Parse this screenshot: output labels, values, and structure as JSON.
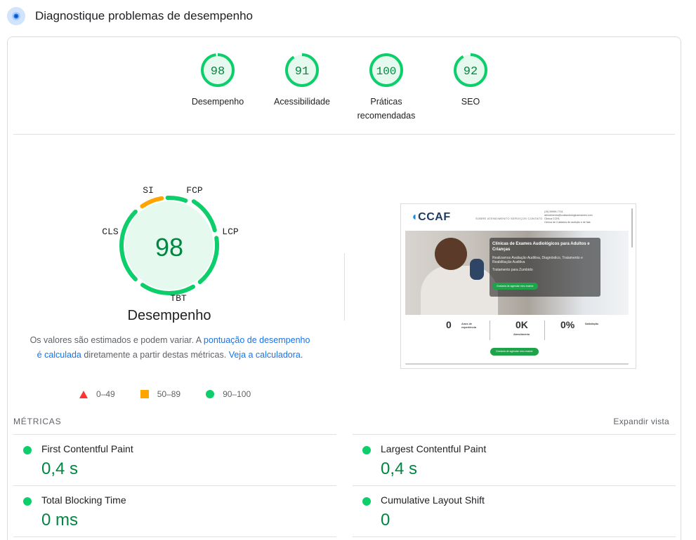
{
  "header": {
    "title": "Diagnostique problemas de desempenho",
    "icon": "lighthouse-icon"
  },
  "scores": [
    {
      "value": 98,
      "label": "Desempenho"
    },
    {
      "value": 91,
      "label": "Acessibilidade"
    },
    {
      "value": 100,
      "label": "Práticas recomendadas"
    },
    {
      "value": 92,
      "label": "SEO"
    }
  ],
  "performance": {
    "score": 98,
    "title": "Desempenho",
    "gauge_labels": {
      "si": "SI",
      "fcp": "FCP",
      "lcp": "LCP",
      "tbt": "TBT",
      "cls": "CLS"
    },
    "desc_1": "Os valores são estimados e podem variar. A ",
    "desc_link_1": "pontuação de desempenho é calculada",
    "desc_2": " diretamente a partir destas métricas. ",
    "desc_link_2": "Veja a calculadora",
    "desc_3": "."
  },
  "legend": {
    "fail": "0–49",
    "average": "50–89",
    "pass": "90–100"
  },
  "screenshot": {
    "logo": "CCAF",
    "nav_links": "SOBRE   ATENDIMENTO   SERVIÇOS   CONTATO",
    "contacts": [
      "(19) 99999-7741",
      "atendimento@ccafaudiologicaexames.com",
      "Clínica CCFA",
      "Clínica de Cuidados de audição e de fala"
    ],
    "hero_heading": "Clínicas de Exames Audiológicos para Adultos e Crianças",
    "hero_text": "Realizamos Avaliação Auditiva, Diagnóstico, Tratamento e Reabilitação Auditiva",
    "hero_text_2": "Tratamento para Zumbido",
    "hero_button": "Gostaria de agendar meu exame",
    "stat_1": "0",
    "stat_1_label": "Anos de experiência",
    "stat_2": "0K",
    "stat_2_label": "Atendimento",
    "stat_3": "0%",
    "stat_3_label": "Satisfação",
    "cta_button": "Gostaria de agendar meu exame"
  },
  "metrics": {
    "title": "MÉTRICAS",
    "expand": "Expandir vista",
    "items": [
      {
        "name": "First Contentful Paint",
        "value": "0,4 s"
      },
      {
        "name": "Largest Contentful Paint",
        "value": "0,4 s"
      },
      {
        "name": "Total Blocking Time",
        "value": "0 ms"
      },
      {
        "name": "Cumulative Layout Shift",
        "value": "0"
      }
    ]
  },
  "colors": {
    "pass": "#0cce6b",
    "average": "#ffa400",
    "fail": "#ff3333",
    "pass_text": "#018642",
    "link": "#1a73e8"
  }
}
